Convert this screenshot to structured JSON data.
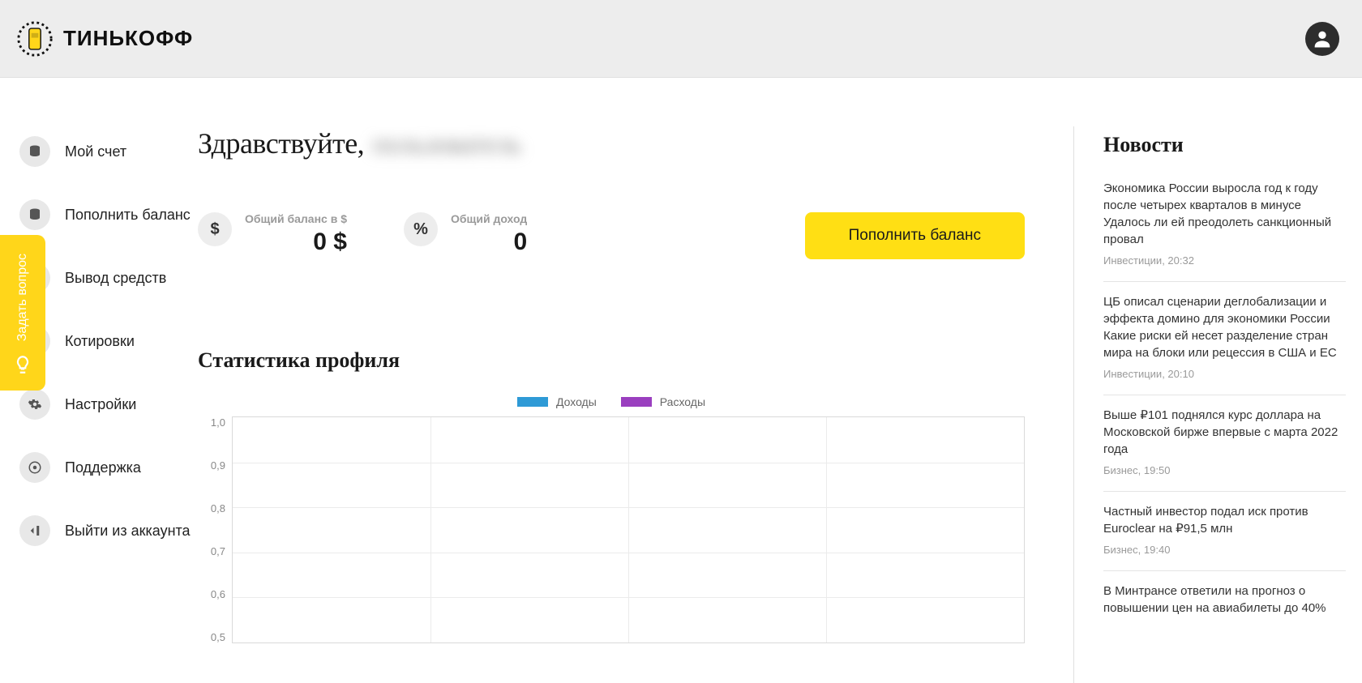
{
  "header": {
    "brand_text": "ТИНЬКОФФ"
  },
  "ask_tab": {
    "label": "Задать вопрос"
  },
  "sidebar": {
    "items": [
      {
        "label": "Мой счет",
        "icon": "database"
      },
      {
        "label": "Пополнить баланс",
        "icon": "database"
      },
      {
        "label": "Вывод средств",
        "icon": ""
      },
      {
        "label": "Котировки",
        "icon": ""
      },
      {
        "label": "Настройки",
        "icon": "gear"
      },
      {
        "label": "Поддержка",
        "icon": "help"
      },
      {
        "label": "Выйти из аккаунта",
        "icon": "logout"
      }
    ]
  },
  "greeting": {
    "prefix": "Здравствуйте,",
    "username_blurred": "пользователь"
  },
  "stats": {
    "balance": {
      "symbol": "$",
      "label": "Общий баланс в $",
      "value": "0 $"
    },
    "income": {
      "symbol": "%",
      "label": "Общий доход",
      "value": "0"
    }
  },
  "topup_button": "Пополнить баланс",
  "chart_section_title": "Статистика профиля",
  "chart_legend": {
    "series1": "Доходы",
    "series2": "Расходы"
  },
  "chart_data": {
    "type": "bar",
    "series": [
      {
        "name": "Доходы",
        "color": "#2e9ad6",
        "values": []
      },
      {
        "name": "Расходы",
        "color": "#9a3fbf",
        "values": []
      }
    ],
    "categories": [],
    "y_ticks": [
      "1,0",
      "0,9",
      "0,8",
      "0,7",
      "0,6",
      "0,5"
    ],
    "ylim": [
      0.5,
      1.0
    ]
  },
  "news": {
    "title": "Новости",
    "items": [
      {
        "text": "Экономика России выросла год к году после четырех кварталов в минусе Удалось ли ей преодолеть санкционный провал",
        "meta": "Инвестиции, 20:32"
      },
      {
        "text": "ЦБ описал сценарии деглобализации и эффекта домино для экономики России Какие риски ей несет разделение стран мира на блоки или рецессия в США и ЕС",
        "meta": "Инвестиции, 20:10"
      },
      {
        "text": "Выше ₽101 поднялся курс доллара на Московской бирже впервые с марта 2022 года",
        "meta": "Бизнес, 19:50"
      },
      {
        "text": "Частный инвестор подал иск против Euroclear на ₽91,5 млн",
        "meta": "Бизнес, 19:40"
      },
      {
        "text": "В Минтрансе ответили на прогноз о повышении цен на авиабилеты до 40%",
        "meta": ""
      }
    ]
  }
}
